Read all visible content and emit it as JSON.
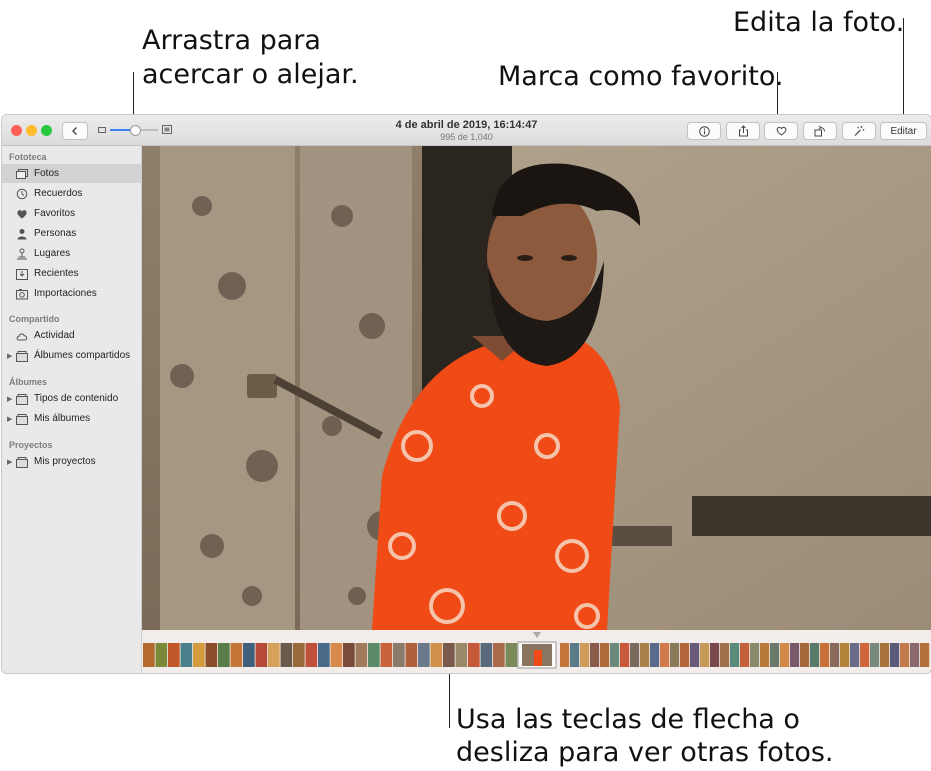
{
  "callouts": {
    "zoom_line1": "Arrastra para",
    "zoom_line2": "acercar o alejar.",
    "favorite": "Marca como favorito.",
    "edit": "Edita la foto.",
    "scroll_line1": "Usa las teclas de flecha o",
    "scroll_line2": "desliza para ver otras fotos."
  },
  "window": {
    "title_date": "4 de abril de 2019, 16:14:47",
    "title_count": "995 de 1,040",
    "edit_button": "Editar"
  },
  "toolbar_icons": [
    "back-chevron-icon",
    "small-thumb-icon",
    "large-thumb-icon",
    "info-icon",
    "share-icon",
    "heart-icon",
    "rotate-icon",
    "magic-wand-icon"
  ],
  "sidebar": {
    "sections": [
      {
        "title": "Fototeca",
        "items": [
          {
            "label": "Fotos",
            "icon": "photos-icon",
            "active": true
          },
          {
            "label": "Recuerdos",
            "icon": "memories-icon"
          },
          {
            "label": "Favoritos",
            "icon": "heart-icon"
          },
          {
            "label": "Personas",
            "icon": "person-icon"
          },
          {
            "label": "Lugares",
            "icon": "pin-icon"
          },
          {
            "label": "Recientes",
            "icon": "recent-icon"
          },
          {
            "label": "Importaciones",
            "icon": "camera-icon"
          }
        ]
      },
      {
        "title": "Compartido",
        "items": [
          {
            "label": "Actividad",
            "icon": "cloud-icon"
          },
          {
            "label": "Álbumes compartidos",
            "icon": "folder-icon",
            "disclosure": true
          }
        ]
      },
      {
        "title": "Álbumes",
        "items": [
          {
            "label": "Tipos de contenido",
            "icon": "folder-icon",
            "disclosure": true
          },
          {
            "label": "Mis álbumes",
            "icon": "folder-icon",
            "disclosure": true
          }
        ]
      },
      {
        "title": "Proyectos",
        "items": [
          {
            "label": "Mis proyectos",
            "icon": "folder-icon",
            "disclosure": true
          }
        ]
      }
    ]
  },
  "colors": {
    "shirt": "#f04a16",
    "wall": "#a89a86",
    "door": "#8c7d68",
    "close": "#fe5f57",
    "minimize": "#febc2e",
    "zoom": "#28c840",
    "slider_accent": "#3b82f6"
  },
  "filmstrip": {
    "thumb_colors": [
      "#b36a2c",
      "#7a8a3a",
      "#c2582a",
      "#4a7f8c",
      "#d49a3c",
      "#8a4f2a",
      "#5a7d4a",
      "#c7763a",
      "#3f5f7a",
      "#b84a3a",
      "#d6a25a",
      "#6a5a4a",
      "#9a6a3a",
      "#c0503a",
      "#4a6a8a",
      "#d88a4a",
      "#7a4a3a",
      "#a07a5a",
      "#5a8a6a",
      "#c8623a",
      "#8a7a6a",
      "#b0603a",
      "#6a7a8a",
      "#d0904a",
      "#7a5a4a",
      "#9a8a6a",
      "#c45a3a",
      "#5a6a7a",
      "#a86a4a",
      "#7a8a5a"
    ],
    "thumb_colors_right": [
      "#c4763a",
      "#5a7a8a",
      "#d09a5a",
      "#8a5a4a",
      "#b06a3a",
      "#6a8a7a",
      "#c85a3a",
      "#7a6a5a",
      "#a8824a",
      "#5a6a8a",
      "#d27a4a",
      "#8a7a5a",
      "#b4643a",
      "#6a5a7a",
      "#c89a5a",
      "#7a4a4a",
      "#a0704a",
      "#5a8a7a",
      "#c2603a",
      "#8a8a6a",
      "#b8783a",
      "#6a7a6a",
      "#d28a4a",
      "#7a5a6a",
      "#a4683a",
      "#5a7a6a",
      "#c8703a",
      "#8a6a5a",
      "#b0823a",
      "#6a6a8a",
      "#d0643a",
      "#7a8a7a",
      "#a8723a",
      "#5a5a7a",
      "#c27a4a",
      "#8a6a6a",
      "#b4703a"
    ]
  }
}
